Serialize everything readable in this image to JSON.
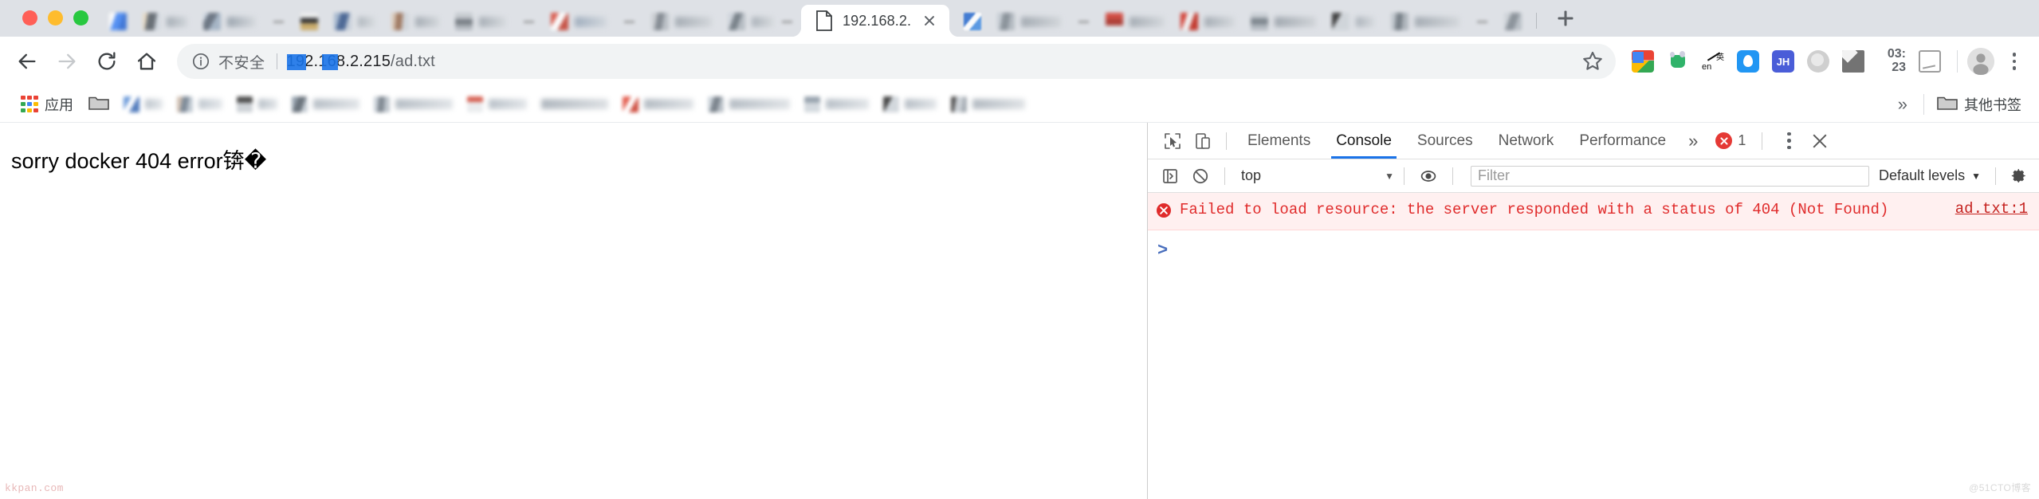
{
  "window": {
    "controls": [
      "close",
      "minimize",
      "maximize"
    ]
  },
  "tabstrip": {
    "active_tab": {
      "title": "192.168.2.",
      "title_faded": ".",
      "favicon": "document-icon",
      "close_label": "×"
    },
    "new_tab_label": "+",
    "background_tab_count": 16
  },
  "toolbar": {
    "back_label": "←",
    "forward_label": "→",
    "reload_label": "⟳",
    "home_label": "⌂",
    "security_label": "不安全",
    "url_host": "192.168.2.215",
    "url_path": "/ad.txt",
    "url_full": "192.168.2.215/ad.txt",
    "bookmark_star_label": "☆",
    "clock_hours": "03:",
    "clock_minutes": "23",
    "profile_label": "profile",
    "menu_label": "⋮",
    "extensions": [
      {
        "name": "google-translate-extension-icon"
      },
      {
        "name": "baidu-netdisk-extension-icon"
      },
      {
        "name": "english-translate-extension-icon"
      },
      {
        "name": "blue-drop-extension-icon"
      },
      {
        "name": "jh-extension-icon"
      },
      {
        "name": "grey-circle-extension-icon"
      },
      {
        "name": "mail-extension-icon"
      },
      {
        "name": "screenshot-extension-icon"
      }
    ]
  },
  "bookmarks_bar": {
    "apps_label": "应用",
    "overflow_label": "»",
    "other_bookmarks_label": "其他书签",
    "blurred_item_count": 13
  },
  "page": {
    "body_text": "sorry docker 404 error",
    "body_mojibake": "锛�",
    "watermark": "kkpan.com"
  },
  "devtools": {
    "inspect_icon": "inspect-element-icon",
    "device_icon": "device-toolbar-icon",
    "tabs": [
      {
        "label": "Elements",
        "active": false
      },
      {
        "label": "Console",
        "active": true
      },
      {
        "label": "Sources",
        "active": false
      },
      {
        "label": "Network",
        "active": false
      },
      {
        "label": "Performance",
        "active": false
      }
    ],
    "more_tabs_label": "»",
    "error_count": "1",
    "settings_menu_label": "⋮",
    "close_label": "×",
    "console_toolbar": {
      "sidebar_toggle": "console-sidebar-icon",
      "clear_label": "clear-console-icon",
      "context": "top",
      "context_caret": "▼",
      "live_expression_icon": "eye-icon",
      "filter_placeholder": "Filter",
      "levels_label": "Default levels",
      "levels_caret": "▼",
      "settings_icon": "gear-icon"
    },
    "messages": [
      {
        "type": "error",
        "text": "Failed to load resource: the server responded with a status of 404 (Not Found)",
        "source": "ad.txt:1"
      }
    ],
    "prompt_symbol": ">",
    "watermark": "@51CTO博客"
  },
  "colors": {
    "tabstrip_bg": "#dee1e6",
    "toolbar_bg": "#ffffff",
    "omnibox_bg": "#f1f3f4",
    "accent_blue": "#1a73e8",
    "error_red": "#e02b2b",
    "error_bg": "#fff0f0",
    "text_primary": "#202124",
    "text_secondary": "#5f6368"
  }
}
